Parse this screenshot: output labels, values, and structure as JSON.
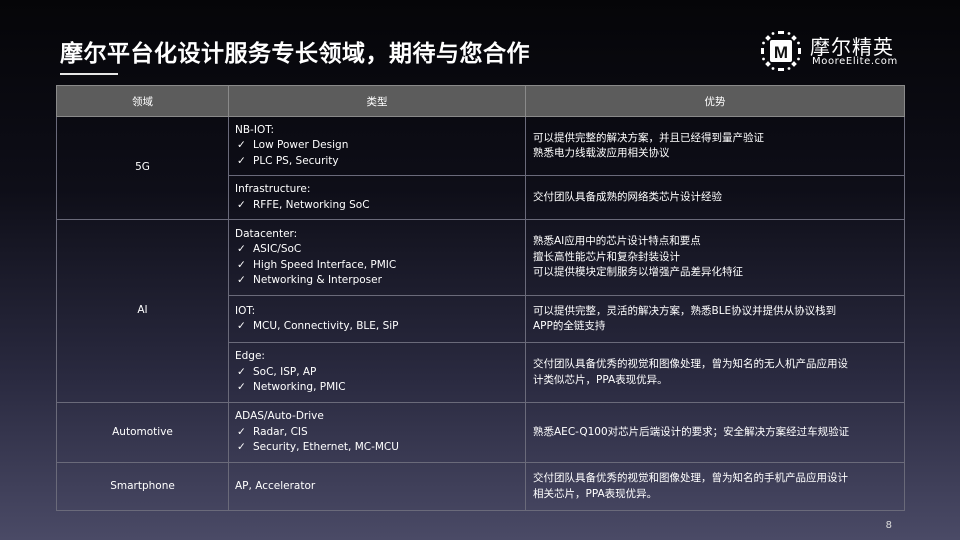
{
  "title": "摩尔平台化设计服务专长领域，期待与您合作",
  "logo": {
    "mark_letter": "M",
    "name_cn": "摩尔精英",
    "name_en": "MooreElite.com"
  },
  "table": {
    "headers": [
      "领域",
      "类型",
      "优势"
    ],
    "check_mark": "✓",
    "groups": [
      {
        "domain": "5G",
        "rows": [
          {
            "type_title": "NB-IOT:",
            "type_items": [
              "Low Power Design",
              "PLC PS, Security"
            ],
            "advantages": [
              "可以提供完整的解决方案，并且已经得到量产验证",
              "熟悉电力线载波应用相关协议"
            ]
          },
          {
            "type_title": "Infrastructure:",
            "type_items": [
              "RFFE, Networking SoC"
            ],
            "advantages": [
              "交付团队具备成熟的网络类芯片设计经验"
            ]
          }
        ]
      },
      {
        "domain": "AI",
        "rows": [
          {
            "type_title": "Datacenter:",
            "type_items": [
              "ASIC/SoC",
              "High Speed Interface, PMIC",
              "Networking & Interposer"
            ],
            "advantages": [
              "熟悉AI应用中的芯片设计特点和要点",
              "擅长高性能芯片和复杂封装设计",
              "可以提供模块定制服务以增强产品差异化特征"
            ]
          },
          {
            "type_title": "IOT:",
            "type_items": [
              "MCU, Connectivity, BLE, SiP"
            ],
            "advantages": [
              "可以提供完整，灵活的解决方案，熟悉BLE协议并提供从协议栈到",
              "APP的全链支持"
            ]
          },
          {
            "type_title": "Edge:",
            "type_items": [
              "SoC, ISP, AP",
              "Networking, PMIC"
            ],
            "advantages": [
              "交付团队具备优秀的视觉和图像处理，曾为知名的无人机产品应用设",
              "计类似芯片，PPA表现优异。"
            ]
          }
        ]
      },
      {
        "domain": "Automotive",
        "rows": [
          {
            "type_title": "ADAS/Auto-Drive",
            "type_items": [
              "Radar, CIS",
              "Security, Ethernet, MC-MCU"
            ],
            "advantages": [
              "熟悉AEC-Q100对芯片后端设计的要求；安全解决方案经过车规验证"
            ]
          }
        ]
      },
      {
        "domain": "Smartphone",
        "rows": [
          {
            "type_title": "AP, Accelerator",
            "type_items": [],
            "advantages": [
              "交付团队具备优秀的视觉和图像处理，曾为知名的手机产品应用设计",
              "相关芯片，PPA表现优异。"
            ]
          }
        ]
      }
    ]
  },
  "page_number": "8"
}
